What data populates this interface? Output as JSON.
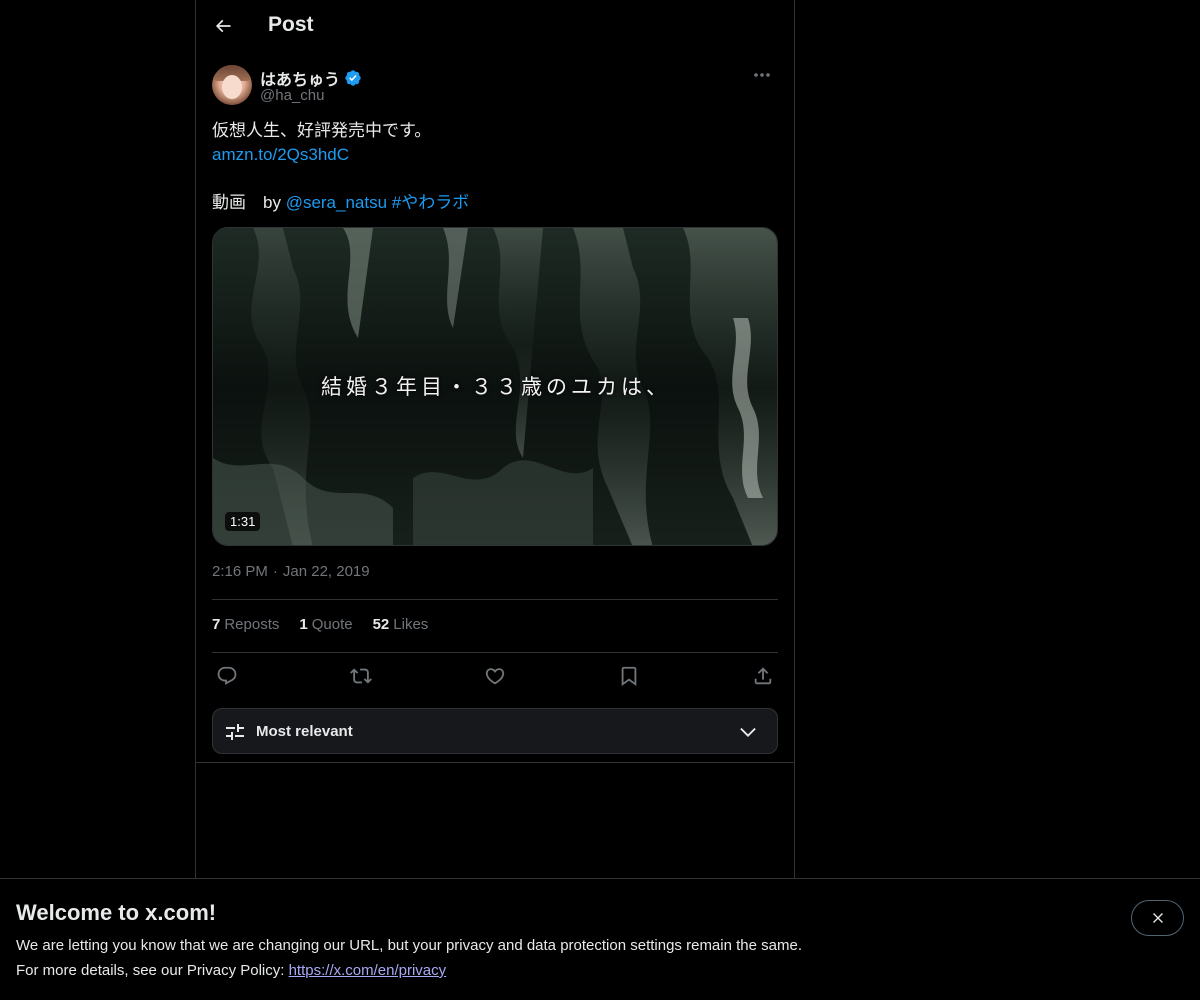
{
  "header": {
    "title": "Post"
  },
  "post": {
    "author": {
      "display_name": "はあちゅう",
      "handle": "@ha_chu",
      "verified": true
    },
    "text": {
      "line1": "仮想人生、好評発売中です。",
      "link": "amzn.to/2Qs3hdC",
      "line3_prefix": "動画　by ",
      "mention": "@sera_natsu",
      "hashtag": "#やわラボ"
    },
    "media": {
      "caption": "結婚３年目・３３歳のユカは、",
      "duration": "1:31"
    },
    "time": "2:16 PM",
    "date": "Jan 22, 2019",
    "stats": {
      "reposts_count": "7",
      "reposts_label": "Reposts",
      "quotes_count": "1",
      "quotes_label": "Quote",
      "likes_count": "52",
      "likes_label": "Likes"
    },
    "actions": [
      "reply-icon",
      "repost-icon",
      "like-icon",
      "bookmark-icon",
      "share-icon"
    ]
  },
  "replies_sort": {
    "label": "Most relevant"
  },
  "banner": {
    "title": "Welcome to x.com!",
    "line1": "We are letting you know that we are changing our URL, but your privacy and data protection settings remain the same.",
    "line2_prefix": "For more details, see our Privacy Policy: ",
    "privacy_link": "https://x.com/en/privacy"
  },
  "colors": {
    "background": "#000000",
    "text": "#e7e9ea",
    "muted": "#71767b",
    "link": "#1d9bf0",
    "border": "#2f3336"
  }
}
